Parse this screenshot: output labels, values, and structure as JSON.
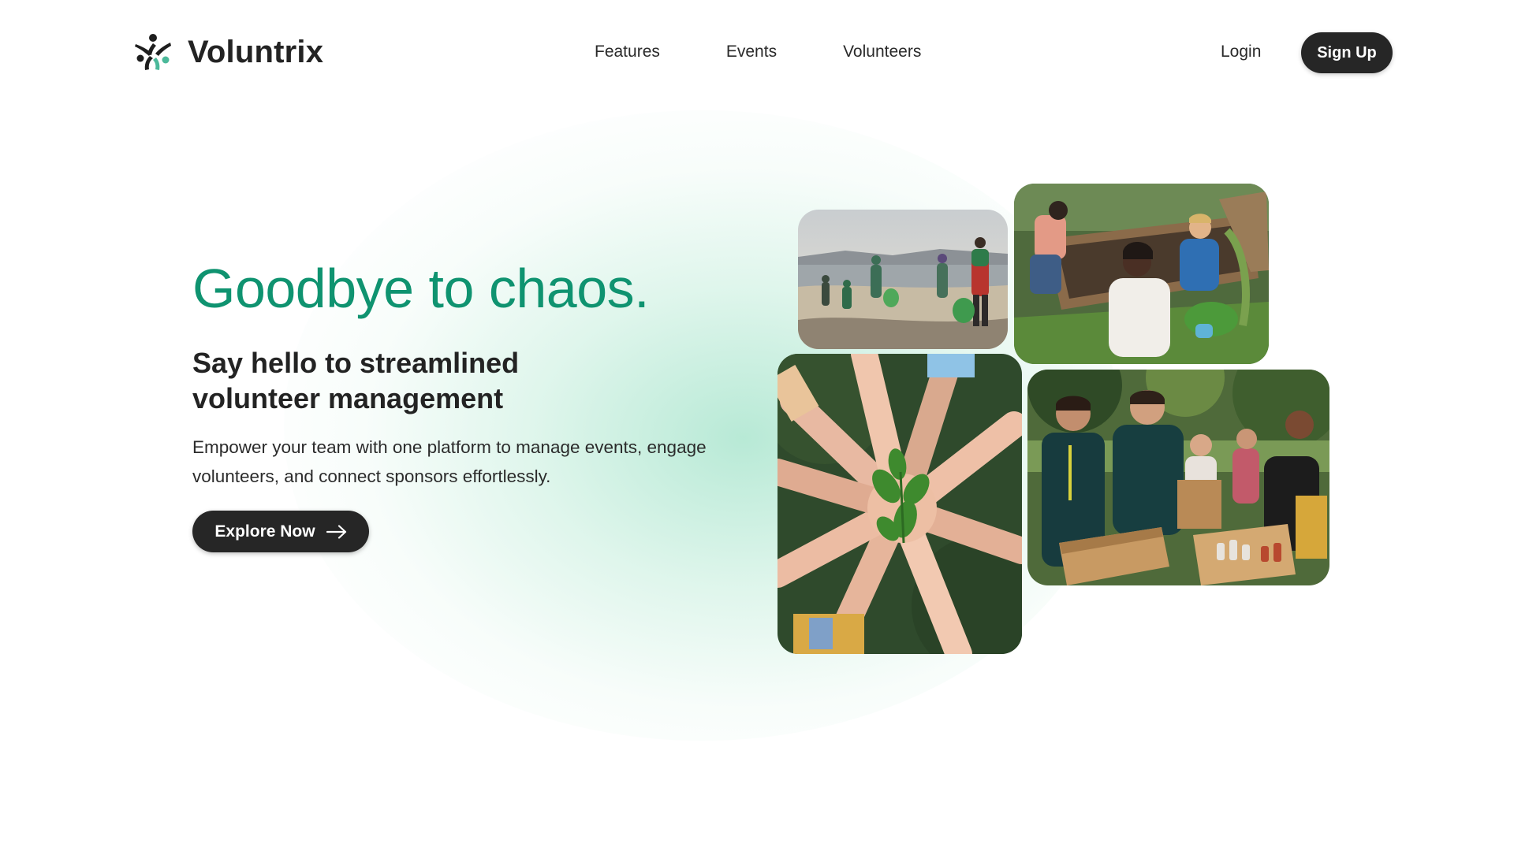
{
  "brand": {
    "name": "Voluntrix",
    "logo_icon": "people-unity-icon",
    "accent": "#0f9370"
  },
  "nav": {
    "links": [
      "Features",
      "Events",
      "Volunteers"
    ],
    "login": "Login",
    "signup": "Sign Up"
  },
  "hero": {
    "title": "Goodbye to chaos.",
    "subtitle": "Say hello to streamlined volunteer management",
    "description": "Empower your team with one platform to manage events, engage volunteers, and connect sponsors effortlessly.",
    "cta": "Explore Now",
    "cta_icon": "arrow-right-icon"
  },
  "photos": [
    {
      "name": "beach-cleanup-photo"
    },
    {
      "name": "community-garden-photo"
    },
    {
      "name": "hands-seedling-photo"
    },
    {
      "name": "food-donation-photo"
    }
  ]
}
